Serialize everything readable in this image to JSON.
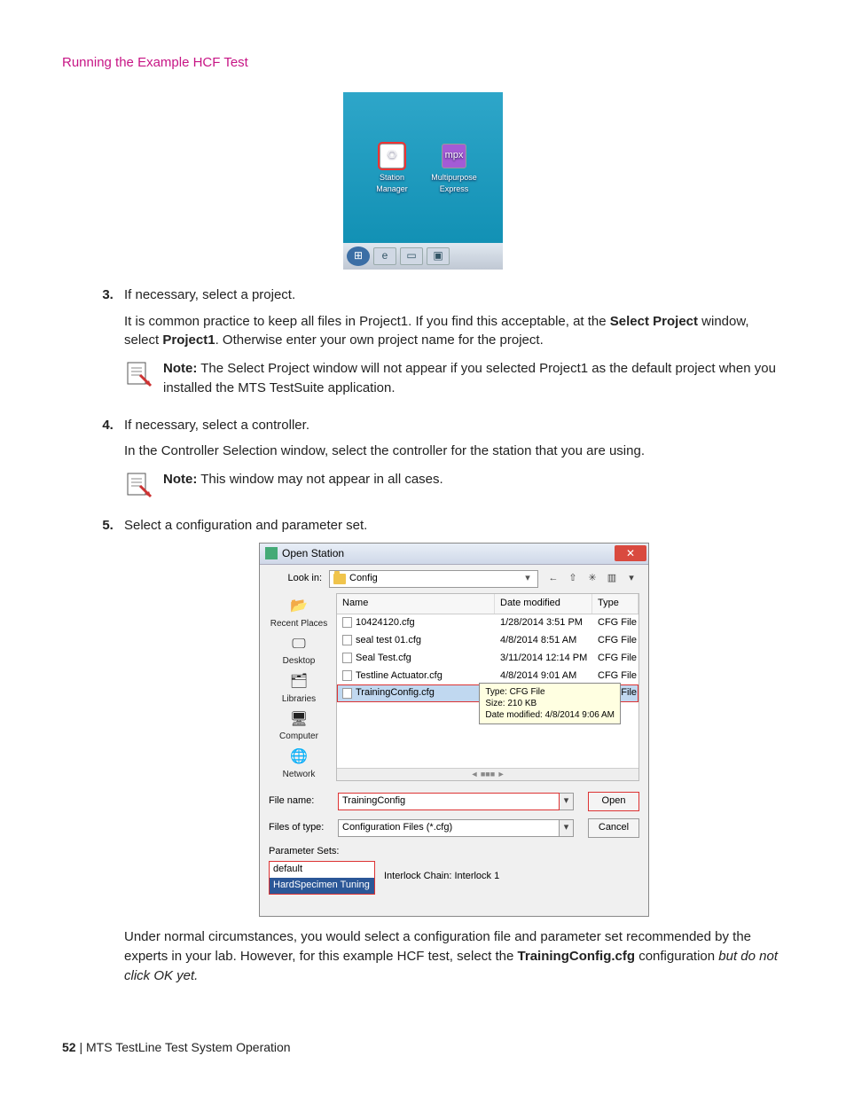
{
  "header": {
    "section_title": "Running the Example HCF Test"
  },
  "desktop": {
    "icon1_label": "Station Manager",
    "icon1_glyph": "⎔",
    "icon2_label": "Multipurpose Express",
    "icon2_glyph": "mpx"
  },
  "steps": {
    "s3": {
      "num": "3.",
      "title": "If necessary, select a project.",
      "p1a": "It is common practice to keep all files in Project1. If you find this acceptable, at the ",
      "p1b": "Select Project",
      "p1c": " window, select ",
      "p1d": "Project1",
      "p1e": ". Otherwise enter your own project name for the project.",
      "note_label": "Note:",
      "note_text": " The Select Project window will not appear if you selected Project1 as the default project when you installed the MTS TestSuite application."
    },
    "s4": {
      "num": "4.",
      "title": "If necessary, select a controller.",
      "p1": "In the Controller Selection window, select the controller for the station that you are using.",
      "note_label": "Note:",
      "note_text": " This window may not appear in all cases."
    },
    "s5": {
      "num": "5.",
      "title": "Select a configuration and parameter set.",
      "after_a": "Under normal circumstances, you would select a configuration file and parameter set recommended by the experts in your lab. However, for this example HCF test, select the ",
      "after_b": "TrainingConfig.cfg",
      "after_c": " configuration ",
      "after_d": "but do not click OK yet."
    }
  },
  "dialog": {
    "title": "Open Station",
    "close_glyph": "✕",
    "lookin_label": "Look in:",
    "lookin_value": "Config",
    "nav_back": "←",
    "nav_up": "⇧",
    "nav_new": "✳",
    "nav_view": "▥",
    "nav_dd": "▾",
    "places": {
      "p1": "Recent Places",
      "p1g": "📂",
      "p2": "Desktop",
      "p2g": "🖵",
      "p3": "Libraries",
      "p3g": "🗂",
      "p4": "Computer",
      "p4g": "🖥",
      "p5": "Network",
      "p5g": "🌐"
    },
    "cols": {
      "name": "Name",
      "date": "Date modified",
      "type": "Type"
    },
    "files": [
      {
        "name": "10424120.cfg",
        "date": "1/28/2014 3:51 PM",
        "type": "CFG File"
      },
      {
        "name": "seal test 01.cfg",
        "date": "4/8/2014 8:51 AM",
        "type": "CFG File"
      },
      {
        "name": "Seal Test.cfg",
        "date": "3/11/2014 12:14 PM",
        "type": "CFG File"
      },
      {
        "name": "Testline Actuator.cfg",
        "date": "4/8/2014 9:01 AM",
        "type": "CFG File"
      },
      {
        "name": "TrainingConfig.cfg",
        "date": "4/8/2014 9:06 AM",
        "type": "CFG File"
      }
    ],
    "tooltip": {
      "l1": "Type: CFG File",
      "l2": "Size: 210 KB",
      "l3": "Date modified: 4/8/2014 9:06 AM"
    },
    "filename_label": "File name:",
    "filename_value": "TrainingConfig",
    "filetype_label": "Files of type:",
    "filetype_value": "Configuration Files (*.cfg)",
    "open_btn": "Open",
    "cancel_btn": "Cancel",
    "param_label": "Parameter Sets:",
    "param_opt1": "default",
    "param_opt2": "HardSpecimen Tuning",
    "interlock": "Interlock Chain: Interlock 1"
  },
  "footer": {
    "page": "52",
    "sep": " | ",
    "book": "MTS TestLine Test System Operation"
  }
}
